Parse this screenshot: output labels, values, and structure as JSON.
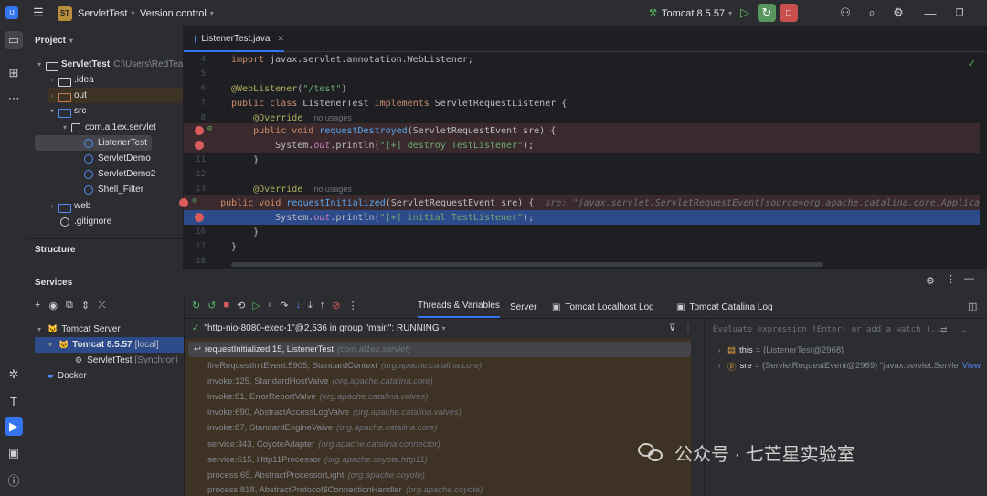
{
  "topbar": {
    "project_badge": "ST",
    "project_name": "ServletTest",
    "vcs_label": "Version control",
    "run_config": "Tomcat 8.5.57"
  },
  "project_panel": {
    "title": "Project",
    "items": [
      {
        "label": "ServletTest",
        "suffix": "C:\\Users\\RedTeam\\",
        "type": "module"
      },
      {
        "label": ".idea",
        "type": "folder"
      },
      {
        "label": "out",
        "type": "folder-orange"
      },
      {
        "label": "src",
        "type": "folder-blue"
      },
      {
        "label": "com.al1ex.servlet",
        "type": "package"
      },
      {
        "label": "ListenerTest",
        "type": "class"
      },
      {
        "label": "ServletDemo",
        "type": "class"
      },
      {
        "label": "ServletDemo2",
        "type": "class"
      },
      {
        "label": "Shell_Filter",
        "type": "class"
      },
      {
        "label": "web",
        "type": "folder-blue"
      },
      {
        "label": ".gitignore",
        "type": "file"
      }
    ],
    "structure_title": "Structure"
  },
  "editor": {
    "tab_label": "ListenerTest.java",
    "lines": [
      {
        "n": "4",
        "text": "import javax.servlet.annotation.WebListener;"
      },
      {
        "n": "5",
        "text": ""
      },
      {
        "n": "6",
        "text": "@WebListener(\"/test\")"
      },
      {
        "n": "7",
        "text": "public class ListenerTest implements ServletRequestListener {"
      },
      {
        "n": "8",
        "text": "@Override",
        "hint": "no usages"
      },
      {
        "n": "",
        "text": "public void requestDestroyed(ServletRequestEvent sre) {"
      },
      {
        "n": "",
        "text": "System.out.println(\"[+] destroy TestListener\");"
      },
      {
        "n": "11",
        "text": "}"
      },
      {
        "n": "12",
        "text": ""
      },
      {
        "n": "13",
        "text": "@Override",
        "hint": "no usages"
      },
      {
        "n": "",
        "text": "public void requestInitialized(ServletRequestEvent sre) {",
        "hint": "sre: \"javax.servlet.ServletRequestEvent[source=org.apache.catalina.core.Applica"
      },
      {
        "n": "",
        "text": "System.out.println(\"[+] initial TestListener\");"
      },
      {
        "n": "16",
        "text": "}"
      },
      {
        "n": "17",
        "text": "}"
      },
      {
        "n": "18",
        "text": ""
      }
    ]
  },
  "services": {
    "title": "Services",
    "tree": [
      {
        "label": "Tomcat Server"
      },
      {
        "label": "Tomcat 8.5.57",
        "suffix": "[local]"
      },
      {
        "label": "ServletTest",
        "suffix": "[Synchroni"
      },
      {
        "label": "Docker"
      }
    ],
    "tabs": [
      "Threads & Variables",
      "Server",
      "Tomcat Localhost Log",
      "Tomcat Catalina Log"
    ],
    "thread_label": "\"http-nio-8080-exec-1\"@2,536 in group \"main\": RUNNING",
    "frames": [
      {
        "m": "requestInitialized:15, ListenerTest",
        "p": "(com.al1ex.servlet)"
      },
      {
        "m": "fireRequestInitEvent:5905, StandardContext",
        "p": "(org.apache.catalina.core)"
      },
      {
        "m": "invoke:125, StandardHostValve",
        "p": "(org.apache.catalina.core)"
      },
      {
        "m": "invoke:81, ErrorReportValve",
        "p": "(org.apache.catalina.valves)"
      },
      {
        "m": "invoke:690, AbstractAccessLogValve",
        "p": "(org.apache.catalina.valves)"
      },
      {
        "m": "invoke:87, StandardEngineValve",
        "p": "(org.apache.catalina.core)"
      },
      {
        "m": "service:343, CoyoteAdapter",
        "p": "(org.apache.catalina.connector)"
      },
      {
        "m": "service:615, Http11Processor",
        "p": "(org.apache.coyote.http11)"
      },
      {
        "m": "process:65, AbstractProcessorLight",
        "p": "(org.apache.coyote)"
      },
      {
        "m": "process:818, AbstractProtocol$ConnectionHandler",
        "p": "(org.apache.coyote)"
      }
    ],
    "eval_placeholder": "Evaluate expression (Enter) or add a watch (..",
    "vars": [
      {
        "name": "this",
        "value": "= {ListenerTest@2968}"
      },
      {
        "name": "sre",
        "value": "= {ServletRequestEvent@2969} \"javax.servlet.Servle",
        "link": "View"
      }
    ]
  },
  "watermark": "公众号 · 七芒星实验室"
}
